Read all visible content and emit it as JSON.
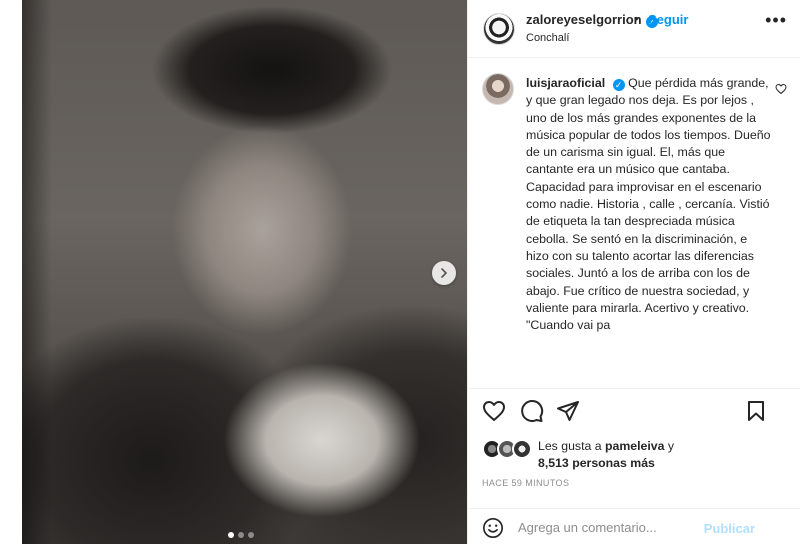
{
  "post": {
    "owner": {
      "username": "zaloreyeselgorrion",
      "location": "Conchalí",
      "follow_label": "Seguir",
      "separator": "•",
      "verified_icon": "verified-badge-icon"
    },
    "caption": {
      "username": "luisjaraoficial",
      "text": "Que pérdida más grande, y que gran legado nos deja. Es por lejos , uno de los más grandes exponentes de la música popular de todos los tiempos. Dueño de un carisma sin igual. El, más que cantante era un músico que cantaba. Capacidad para improvisar en el escenario como nadie. Historia , calle , cercanía. Vistió de etiqueta la tan despreciada música cebolla. Se sentó en la discriminación, e hizo con su talento acortar las diferencias sociales. Juntó a los de arriba con los de abajo. Fue crítico de nuestra sociedad, y valiente para mirarla. Acertivo y creativo. \"Cuando vai pa"
    },
    "likes": {
      "prefix": "Les gusta a",
      "user": "pameleiva",
      "conjunction": "y",
      "count_text": "8,513 personas más"
    },
    "timestamp": "Hace 59 minutos",
    "comment": {
      "placeholder": "Agrega un comentario...",
      "publish_label": "Publicar"
    },
    "carousel": {
      "slides": 3,
      "active_index": 0
    }
  },
  "colors": {
    "accent": "#0095f6",
    "publish_disabled": "#b2dffc",
    "muted": "#8e8e8e",
    "text": "#262626"
  }
}
